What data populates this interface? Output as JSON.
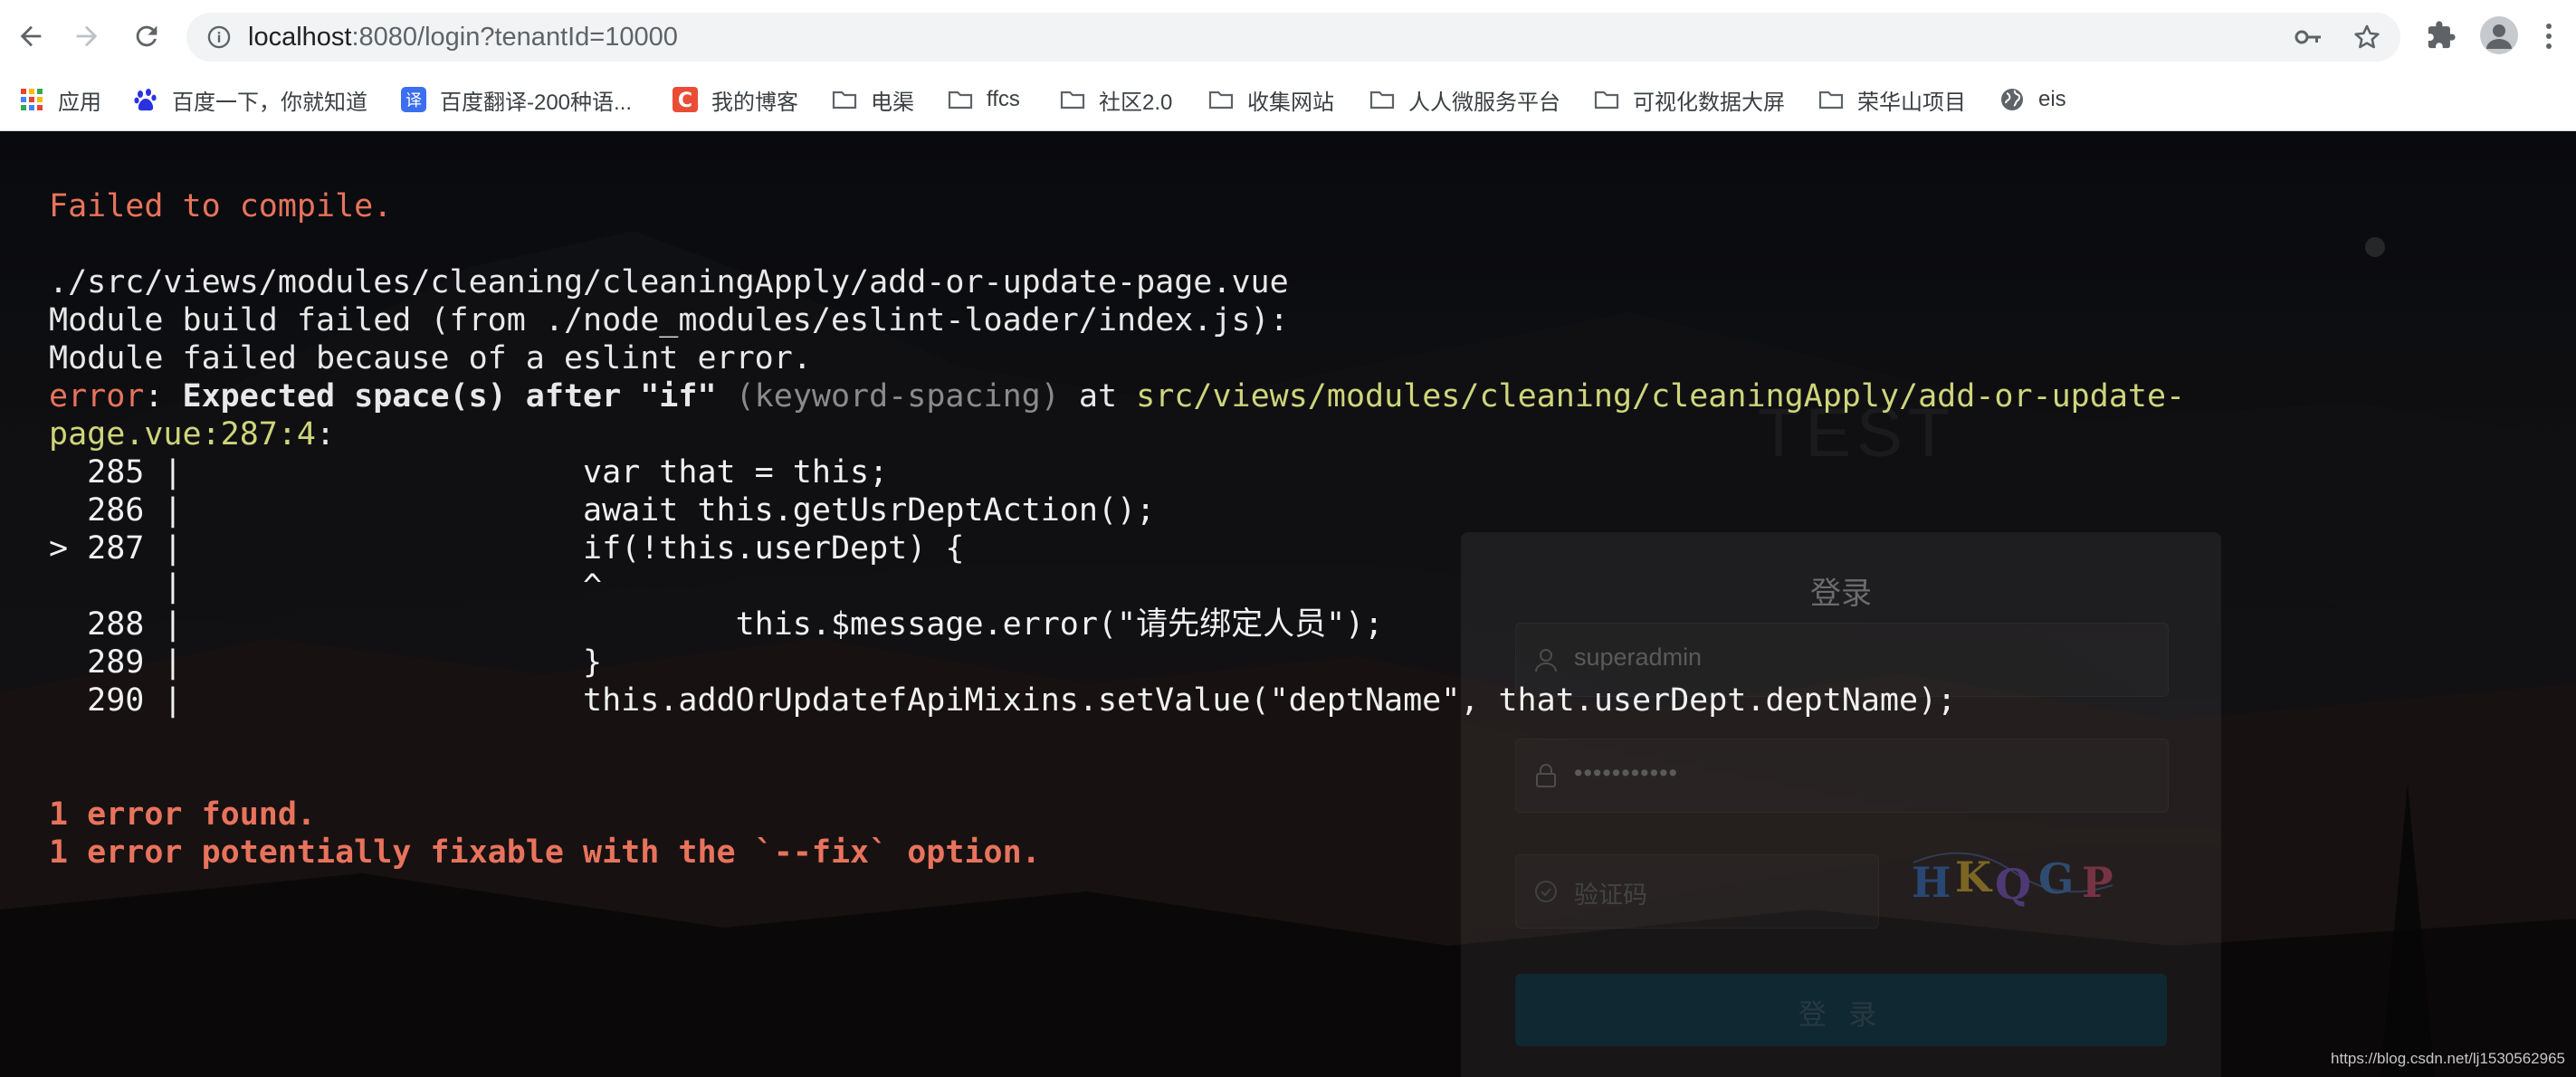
{
  "browser": {
    "url_host": "localhost",
    "url_rest": ":8080/login?tenantId=10000",
    "bookmarks": [
      {
        "label": "应用",
        "icon": "apps-grid-icon"
      },
      {
        "label": "百度一下，你就知道",
        "icon": "baidu-paw-icon"
      },
      {
        "label": "百度翻译-200种语...",
        "icon": "baidu-translate-icon"
      },
      {
        "label": "我的博客",
        "icon": "csdn-c-icon"
      },
      {
        "label": "电渠",
        "icon": "folder-icon"
      },
      {
        "label": "ffcs",
        "icon": "folder-icon"
      },
      {
        "label": "社区2.0",
        "icon": "folder-icon"
      },
      {
        "label": "收集网站",
        "icon": "folder-icon"
      },
      {
        "label": "人人微服务平台",
        "icon": "folder-icon"
      },
      {
        "label": "可视化数据大屏",
        "icon": "folder-icon"
      },
      {
        "label": "荣华山项目",
        "icon": "folder-icon"
      },
      {
        "label": "eis",
        "icon": "globe-icon"
      }
    ]
  },
  "error_overlay": {
    "title": "Failed to compile.",
    "file_path": "./src/views/modules/cleaning/cleaningApply/add-or-update-page.vue",
    "module_line": "Module build failed (from ./node_modules/eslint-loader/index.js):",
    "because_line": "Module failed because of a eslint error.",
    "error_label": "error",
    "error_message": "Expected space(s) after \"if\"",
    "rule": "(keyword-spacing)",
    "at": "at",
    "location_1": "src/views/modules/cleaning/cleaningApply/add-or-update-",
    "location_2": "page.vue:287:4",
    "code_lines": [
      "  285 |                     var that = this;",
      "  286 |                     await this.getUsrDeptAction();",
      "> 287 |                     if(!this.userDept) {",
      "      |                     ^",
      "  288 |                             this.$message.error(\"请先绑定人员\");",
      "  289 |                     }",
      "  290 |                     this.addOrUpdatefApiMixins.setValue(\"deptName\", that.userDept.deptName);"
    ],
    "summary_1": "1 error found.",
    "summary_2": "1 error potentially fixable with the `--fix` option."
  },
  "login": {
    "watermark": "TEST",
    "title": "登录",
    "username": "superadmin",
    "password": "•••••••••••",
    "captcha_placeholder": "验证码",
    "captcha_text": "HKQGP",
    "button": "登 录"
  },
  "footer_watermark": "https://blog.csdn.net/lj1530562965",
  "colors": {
    "error_red": "#e8735c",
    "path_yellow": "#cfd57a",
    "rule_gray": "#8a8a8a"
  }
}
